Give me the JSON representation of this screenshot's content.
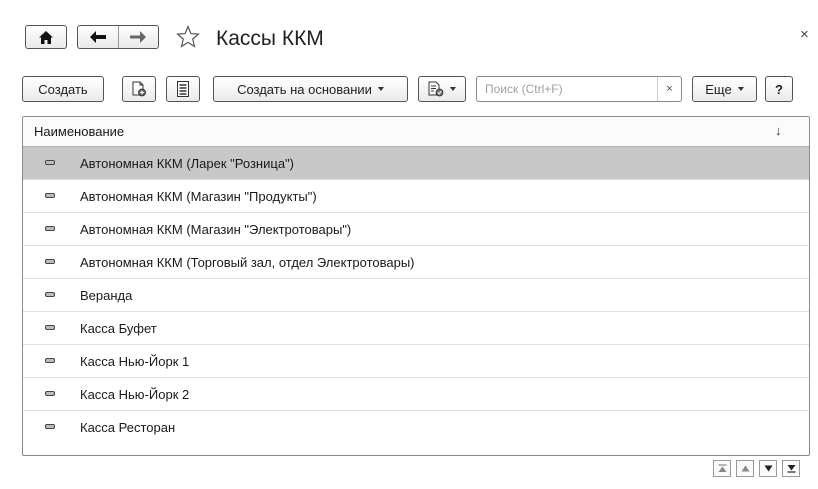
{
  "window": {
    "title": "Кассы ККМ",
    "close_glyph": "×"
  },
  "nav": {
    "home_icon": "home-icon",
    "back_icon": "arrow-left-icon",
    "forward_icon": "arrow-right-icon",
    "favorite_icon": "star-icon"
  },
  "toolbar": {
    "create_label": "Создать",
    "copy_icon": "copy-document-icon",
    "list_icon": "list-icon",
    "create_based_label": "Создать на основании",
    "reports_icon": "reports-icon",
    "search": {
      "placeholder": "Поиск (Ctrl+F)",
      "value": "",
      "clear_glyph": "×"
    },
    "more_label": "Еще",
    "help_label": "?"
  },
  "table": {
    "column_header": "Наименование",
    "sort_glyph": "↓",
    "rows": [
      "Автономная ККМ (Ларек \"Розница\")",
      "Автономная ККМ (Магазин \"Продукты\")",
      "Автономная ККМ (Магазин \"Электротовары\")",
      "Автономная ККМ (Торговый зал, отдел Электротовары)",
      "Веранда",
      "Касса Буфет",
      "Касса Нью-Йорк 1",
      "Касса Нью-Йорк 2",
      "Касса Ресторан"
    ],
    "selected_row": 0,
    "row_icon": "catalog-item-icon"
  },
  "pager": {
    "icons": [
      "first-page-icon",
      "prev-page-icon",
      "next-page-icon",
      "last-page-icon"
    ]
  },
  "colors": {
    "selected_row_bg": "#c8c8c8",
    "border": "#8a8a8a"
  }
}
